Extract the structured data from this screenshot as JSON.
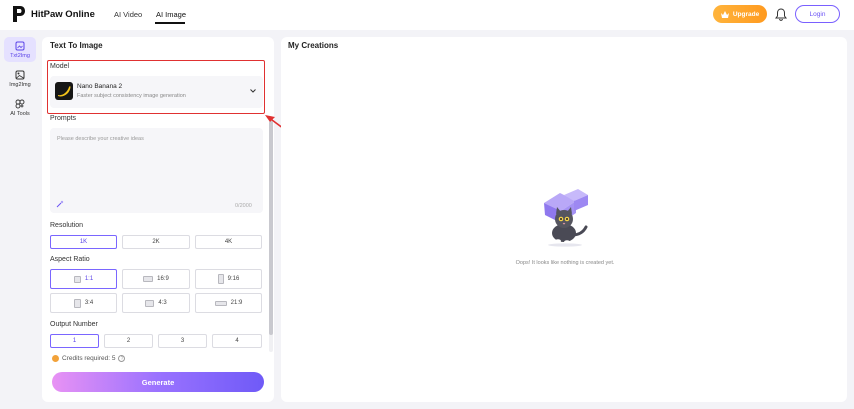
{
  "header": {
    "brand": "HitPaw Online",
    "nav": [
      "AI Video",
      "AI Image"
    ],
    "upgrade_label": "Upgrade",
    "login_label": "Login"
  },
  "sidebar": {
    "items": [
      {
        "label": "Txt2Img",
        "icon": "image-text-icon"
      },
      {
        "label": "Img2Img",
        "icon": "image-icon"
      },
      {
        "label": "AI Tools",
        "icon": "tools-icon"
      }
    ]
  },
  "left_panel": {
    "title": "Text To Image",
    "model_label": "Model",
    "model_name": "Nano Banana 2",
    "model_desc": "Faster subject consistency image generation",
    "prompts_label": "Prompts",
    "prompt_placeholder": "Please describe your creative ideas",
    "prompt_counter": "0/2000",
    "resolution_label": "Resolution",
    "resolutions": [
      "1K",
      "2K",
      "4K"
    ],
    "aspect_label": "Aspect Ratio",
    "aspects": [
      "1:1",
      "16:9",
      "9:16",
      "3:4",
      "4:3",
      "21:9"
    ],
    "output_label": "Output Number",
    "outputs": [
      "1",
      "2",
      "3",
      "4"
    ],
    "credits_text": "Credits required: 5",
    "generate_label": "Generate"
  },
  "right_panel": {
    "title": "My Creations",
    "empty_text": "Oops! It looks like nothing is created yet."
  },
  "colors": {
    "accent": "#6b52f5",
    "upgrade": "#ff9a1f",
    "highlight": "#e03131"
  }
}
